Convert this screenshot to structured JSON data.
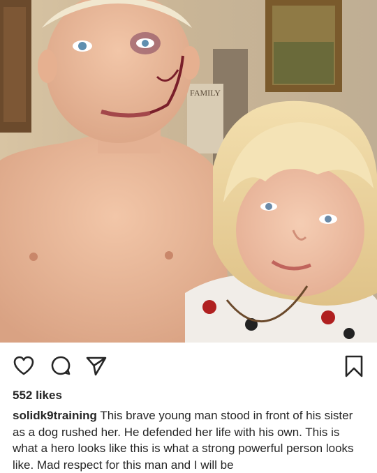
{
  "post": {
    "image_alt": "",
    "wall_sign": "FAMILY",
    "likes_text": "552 likes",
    "username": "solidk9training",
    "caption_text": "This brave young man stood in front of his sister as a dog rushed her. He defended her life with his own. This is what a hero looks like this is what a strong powerful person looks like. Mad respect for this man and I will be"
  },
  "icons": {
    "like": "heart-icon",
    "comment": "comment-bubble-icon",
    "share": "paper-plane-icon",
    "save": "bookmark-icon"
  },
  "colors": {
    "text": "#262626",
    "background": "#ffffff"
  }
}
